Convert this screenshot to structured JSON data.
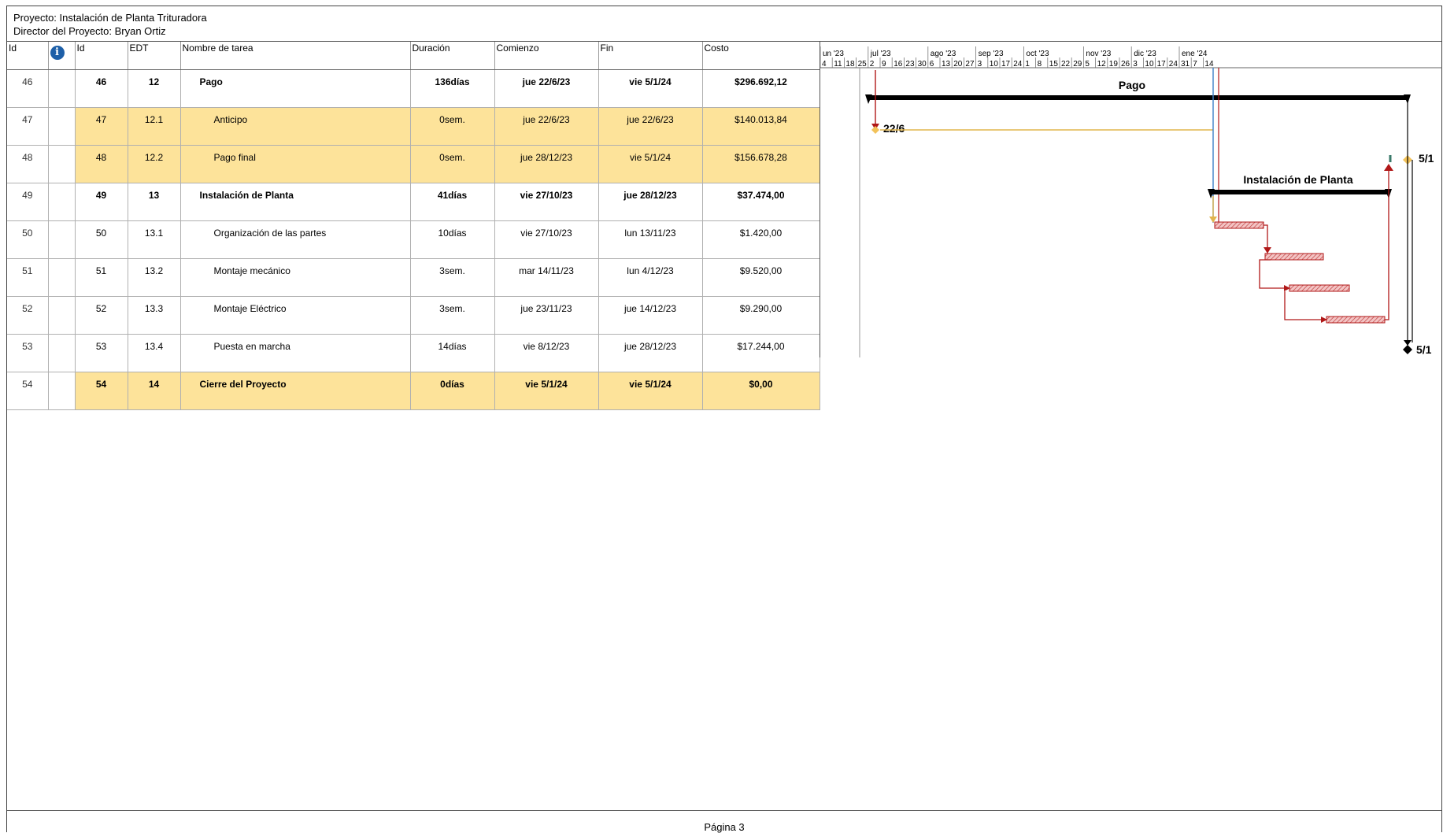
{
  "project": {
    "line1": "Proyecto: Instalación de Planta Trituradora",
    "line2": "Director del Proyecto: Bryan Ortiz"
  },
  "columns": {
    "rowid": "Id",
    "id": "Id",
    "edt": "EDT",
    "name": "Nombre de tarea",
    "duration": "Duración",
    "start": "Comienzo",
    "end": "Fin",
    "cost": "Costo"
  },
  "rows": [
    {
      "rowid": "46",
      "id": "46",
      "edt": "12",
      "name": "Pago",
      "duration": "136días",
      "start": "jue 22/6/23",
      "end": "vie 5/1/24",
      "cost": "$296.692,12"
    },
    {
      "rowid": "47",
      "id": "47",
      "edt": "12.1",
      "name": "Anticipo",
      "duration": "0sem.",
      "start": "jue 22/6/23",
      "end": "jue 22/6/23",
      "cost": "$140.013,84"
    },
    {
      "rowid": "48",
      "id": "48",
      "edt": "12.2",
      "name": "Pago final",
      "duration": "0sem.",
      "start": "jue 28/12/23",
      "end": "vie 5/1/24",
      "cost": "$156.678,28"
    },
    {
      "rowid": "49",
      "id": "49",
      "edt": "13",
      "name": "Instalación de Planta",
      "duration": "41días",
      "start": "vie 27/10/23",
      "end": "jue 28/12/23",
      "cost": "$37.474,00"
    },
    {
      "rowid": "50",
      "id": "50",
      "edt": "13.1",
      "name": "Organización de las partes",
      "duration": "10días",
      "start": "vie 27/10/23",
      "end": "lun 13/11/23",
      "cost": "$1.420,00"
    },
    {
      "rowid": "51",
      "id": "51",
      "edt": "13.2",
      "name": "Montaje mecánico",
      "duration": "3sem.",
      "start": "mar 14/11/23",
      "end": "lun 4/12/23",
      "cost": "$9.520,00"
    },
    {
      "rowid": "52",
      "id": "52",
      "edt": "13.3",
      "name": "Montaje Eléctrico",
      "duration": "3sem.",
      "start": "jue 23/11/23",
      "end": "jue 14/12/23",
      "cost": "$9.290,00"
    },
    {
      "rowid": "53",
      "id": "53",
      "edt": "13.4",
      "name": "Puesta en marcha",
      "duration": "14días",
      "start": "vie 8/12/23",
      "end": "jue 28/12/23",
      "cost": "$17.244,00"
    },
    {
      "rowid": "54",
      "id": "54",
      "edt": "14",
      "name": "Cierre del Proyecto",
      "duration": "0días",
      "start": "vie 5/1/24",
      "end": "vie 5/1/24",
      "cost": "$0,00"
    }
  ],
  "timeline": {
    "months": [
      "un '23",
      "jul '23",
      "ago '23",
      "sep '23",
      "oct '23",
      "nov '23",
      "dic '23",
      "ene '24"
    ],
    "days": [
      "4",
      "11",
      "18",
      "25",
      "2",
      "9",
      "16",
      "23",
      "30",
      "6",
      "13",
      "20",
      "27",
      "3",
      "10",
      "17",
      "24",
      "1",
      "8",
      "15",
      "22",
      "29",
      "5",
      "12",
      "19",
      "26",
      "3",
      "10",
      "17",
      "24",
      "31",
      "7",
      "14"
    ]
  },
  "gantt_labels": {
    "pago": "Pago",
    "anticipo": "22/6",
    "pago_final": "5/1",
    "instalacion": "Instalación de Planta",
    "cierre": "5/1"
  },
  "colors": {
    "highlight": "#fde39a",
    "task_bar": "#e7a3a3",
    "link": "#b01818",
    "milestone": "#f2c25a"
  },
  "footer": {
    "page": "Página 3"
  }
}
